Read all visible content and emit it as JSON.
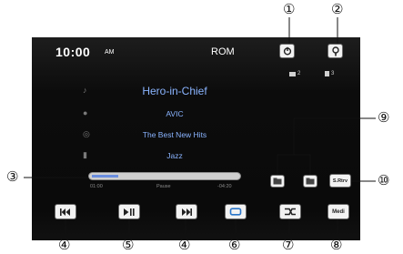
{
  "header": {
    "time": "10:00",
    "ampm": "AM",
    "source": "ROM"
  },
  "counts": {
    "folders": "2",
    "files": "3"
  },
  "track": {
    "title": "Hero-in-Chief",
    "artist": "AVIC",
    "album": "The Best New Hits",
    "genre": "Jazz"
  },
  "progress": {
    "elapsed": "01:00",
    "status": "Pause",
    "remaining": "-04:20",
    "fraction": 0.18
  },
  "buttons": {
    "srev": "S.Rtrv",
    "media": "Medi"
  },
  "callouts": [
    "①",
    "②",
    "③",
    "④",
    "⑤",
    "④",
    "⑥",
    "⑦",
    "⑧",
    "⑨",
    "⑩"
  ]
}
